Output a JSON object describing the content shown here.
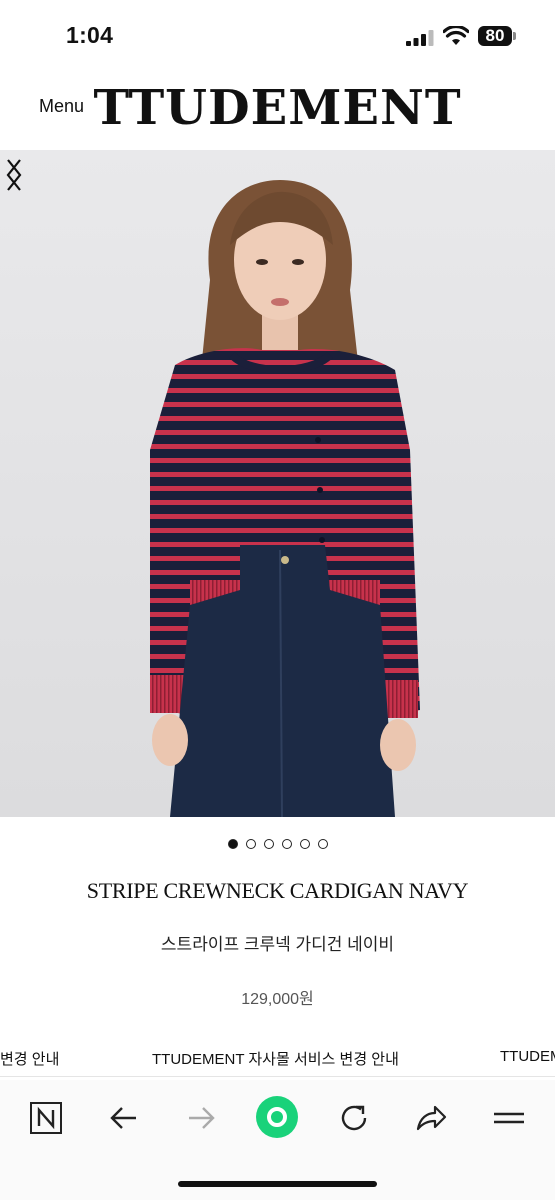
{
  "status_bar": {
    "time": "1:04",
    "battery": "80"
  },
  "header": {
    "menu_label": "Menu",
    "brand": "TTUDEMENT"
  },
  "carousel": {
    "slide_count": 6,
    "active_index": 0
  },
  "product": {
    "name_en": "STRIPE CREWNECK CARDIGAN NAVY",
    "name_ko": "스트라이프 크루넥 가디건 네이비",
    "price": "129,000원"
  },
  "notice": {
    "items": [
      "변경 안내",
      "TTUDEMENT 자사몰 서비스 변경 안내",
      "TTUDEMEN"
    ]
  },
  "colors": {
    "accent_green": "#19d27a",
    "stripe_red": "#c8324c",
    "navy": "#1b1f3a",
    "denim": "#1c2a45"
  },
  "toolbar": {
    "icons": [
      "naver-n-icon",
      "back-arrow-icon",
      "forward-arrow-icon",
      "green-home-icon",
      "refresh-icon",
      "share-icon",
      "menu-lines-icon"
    ]
  }
}
